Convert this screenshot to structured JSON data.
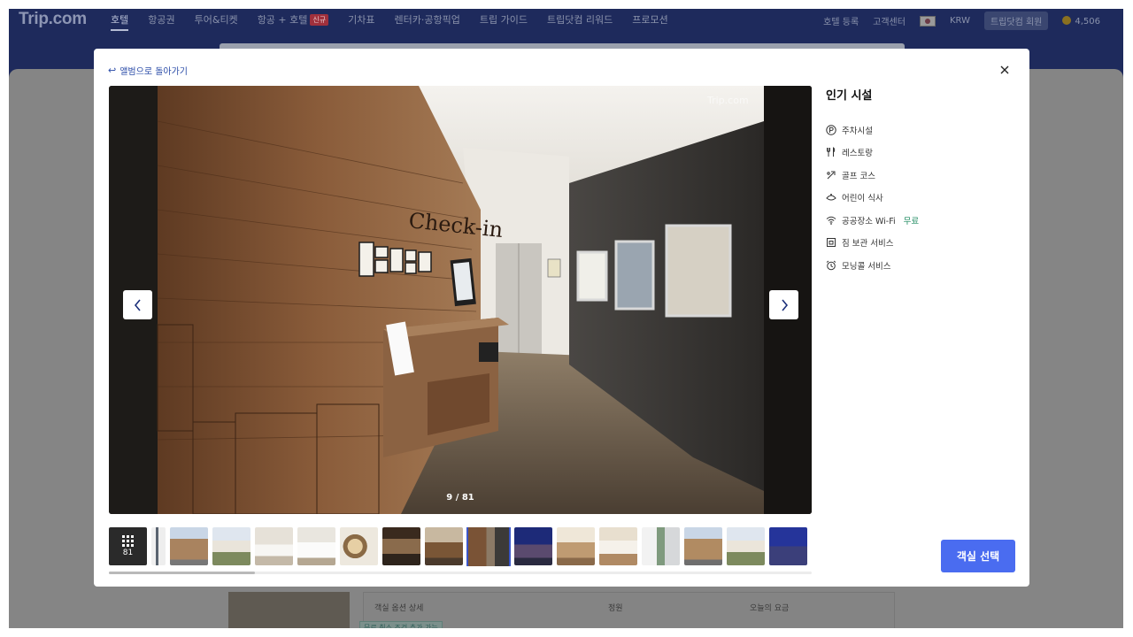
{
  "header": {
    "logo": "Trip.com",
    "nav": [
      {
        "label": "호텔",
        "active": true
      },
      {
        "label": "항공권"
      },
      {
        "label": "투어&티켓"
      },
      {
        "label": "항공 + 호텔",
        "badge": "신규"
      },
      {
        "label": "기차표"
      },
      {
        "label": "렌터카·공항픽업"
      },
      {
        "label": "트립 가이드"
      },
      {
        "label": "트립닷컴 리워드"
      },
      {
        "label": "프로모션"
      }
    ],
    "right": {
      "hotel_register": "호텔 등록",
      "customer_center": "고객센터",
      "currency": "KRW",
      "member": "트립닷컴 회원",
      "points": "4,506"
    }
  },
  "background_table": {
    "col_room_options": "객실 옵션 상세",
    "col_capacity": "정원",
    "col_today_price": "오늘의 요금",
    "tag": "무료 취소 조건 추가 가능"
  },
  "gallery": {
    "back_label": "앨범으로 돌아가기",
    "counter": "9 / 81",
    "total_photos": "81",
    "selected_index": 9
  },
  "amenities": {
    "title": "인기 시설",
    "items": [
      {
        "icon": "parking-icon",
        "label": "주차시설"
      },
      {
        "icon": "restaurant-icon",
        "label": "레스토랑"
      },
      {
        "icon": "golf-icon",
        "label": "골프 코스"
      },
      {
        "icon": "kids-meal-icon",
        "label": "어린이 식사"
      },
      {
        "icon": "wifi-icon",
        "label": "공공장소 Wi-Fi",
        "suffix": "무료"
      },
      {
        "icon": "luggage-icon",
        "label": "짐 보관 서비스"
      },
      {
        "icon": "alarm-clock-icon",
        "label": "모닝콜 서비스"
      }
    ]
  },
  "cta": {
    "select_room": "객실 선택"
  },
  "colors": {
    "accent": "#4a6cf0",
    "link": "#2b4ca8",
    "free": "#1e8a60",
    "header_bg": "#1e2a5c"
  }
}
